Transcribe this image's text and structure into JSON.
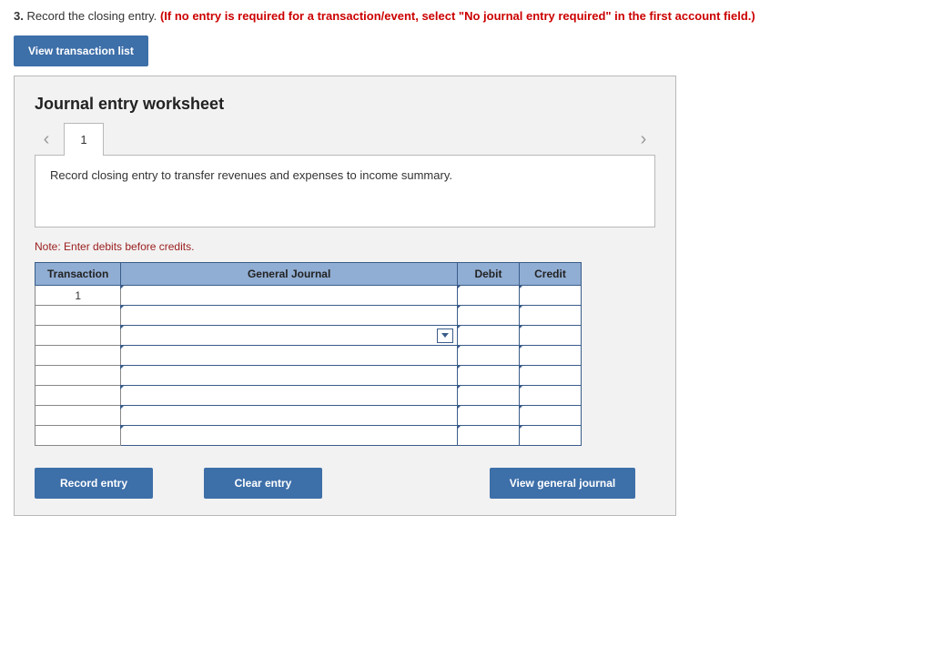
{
  "question": {
    "number": "3.",
    "text": "Record the closing entry.",
    "hint": "(If no entry is required for a transaction/event, select \"No journal entry required\" in the first account field.)"
  },
  "buttons": {
    "view_transaction_list": "View transaction list",
    "record_entry": "Record entry",
    "clear_entry": "Clear entry",
    "view_general_journal": "View general journal"
  },
  "worksheet": {
    "title": "Journal entry worksheet",
    "tab": "1",
    "instruction": "Record closing entry to transfer revenues and expenses to income summary.",
    "note": "Note: Enter debits before credits.",
    "headers": {
      "transaction": "Transaction",
      "general_journal": "General Journal",
      "debit": "Debit",
      "credit": "Credit"
    },
    "first_transaction": "1"
  }
}
